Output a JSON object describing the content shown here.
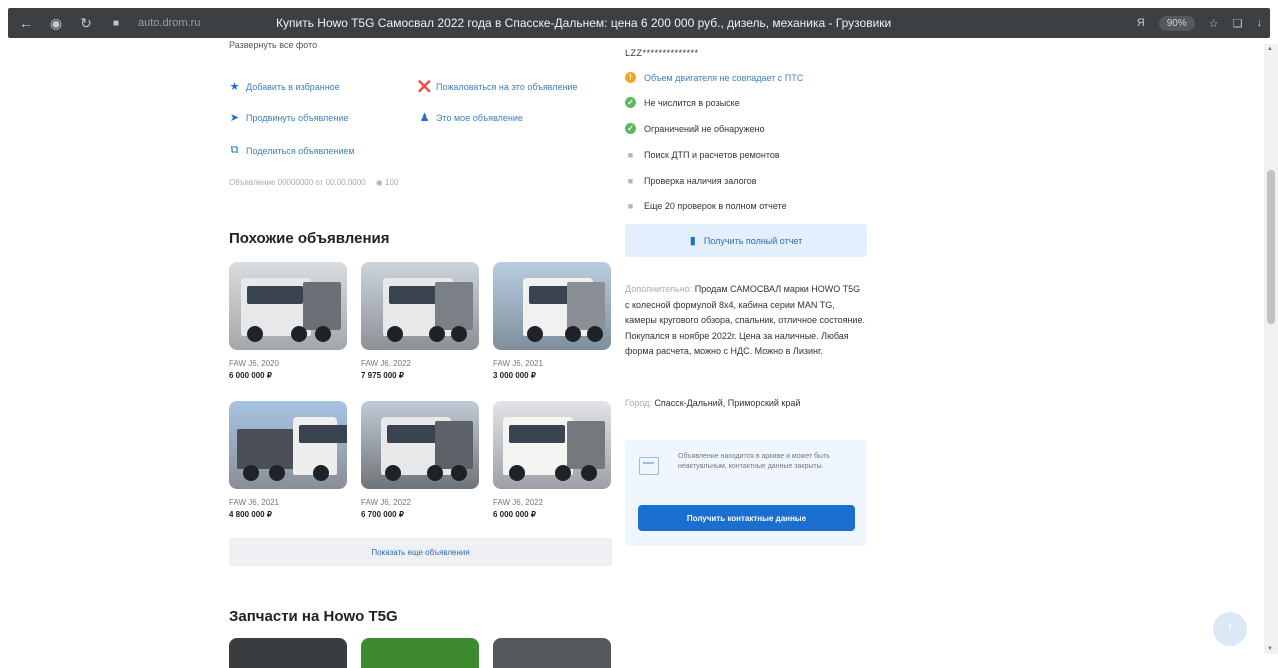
{
  "browser": {
    "domain": "auto.drom.ru",
    "title": "Купить Howo T5G Самосвал 2022 года в Спасске-Дальнем: цена 6 200 000 руб., дизель, механика - Грузовики",
    "zoom": "90%"
  },
  "left": {
    "expand_photos": "Развернуть все фото",
    "actions": {
      "favorite": "Добавить в избранное",
      "complain": "Пожаловаться на это объявление",
      "promote": "Продвинуть объявление",
      "mine": "Это мое объявление",
      "share": "Поделиться объявлением"
    },
    "meta": "Объявление 00000000 от 00.00.0000",
    "views": "100",
    "similar_title": "Похожие объявления",
    "similar": [
      {
        "model": "FAW J6, 2020",
        "price": "6 000 000 ₽"
      },
      {
        "model": "FAW J6, 2022",
        "price": "7 975 000 ₽"
      },
      {
        "model": "FAW J6, 2021",
        "price": "3 000 000 ₽"
      },
      {
        "model": "FAW J6, 2021",
        "price": "4 800 000 ₽"
      },
      {
        "model": "FAW J6, 2022",
        "price": "6 700 000 ₽"
      },
      {
        "model": "FAW J6, 2022",
        "price": "6 000 000 ₽"
      }
    ],
    "more_button": "Показать еще объявления",
    "parts_title": "Запчасти на Howo T5G"
  },
  "right": {
    "vin": "LZZ**************",
    "checks": [
      {
        "text": "Объем двигателя не совпадает с ПТС",
        "status": "warning",
        "color": "#f5a623"
      },
      {
        "text": "Не числится в розыске",
        "status": "ok",
        "color": "#5cb85c"
      },
      {
        "text": "Ограничений не обнаружено",
        "status": "ok",
        "color": "#5cb85c"
      },
      {
        "text": "Поиск ДТП и расчетов ремонтов",
        "status": "locked"
      },
      {
        "text": "Проверка наличия залогов",
        "status": "locked"
      },
      {
        "text": "Еще 20 проверок в полном отчете",
        "status": "locked"
      }
    ],
    "report_button": "Получить полный отчет",
    "desc_label": "Дополнительно:",
    "desc_text": "Продам САМОСВАЛ марки HOWO T5G с колесной формулой 8x4, кабина серии MAN TG, камеры кругового обзора, спальник, отличное состояние. Покупался в ноябре 2022г. Цена за наличные. Любая форма расчета, можно с НДС. Можно в Лизинг.",
    "city_label": "Город:",
    "city": "Спасск-Дальний, Приморский край",
    "archive_text": "Объявление находится в архиве и может быть неактуальным, контактные данные закрыты.",
    "contact_button": "Получить контактные данные"
  },
  "colors": {
    "accent": "#1b6fd0",
    "link": "#3e7fc4"
  }
}
